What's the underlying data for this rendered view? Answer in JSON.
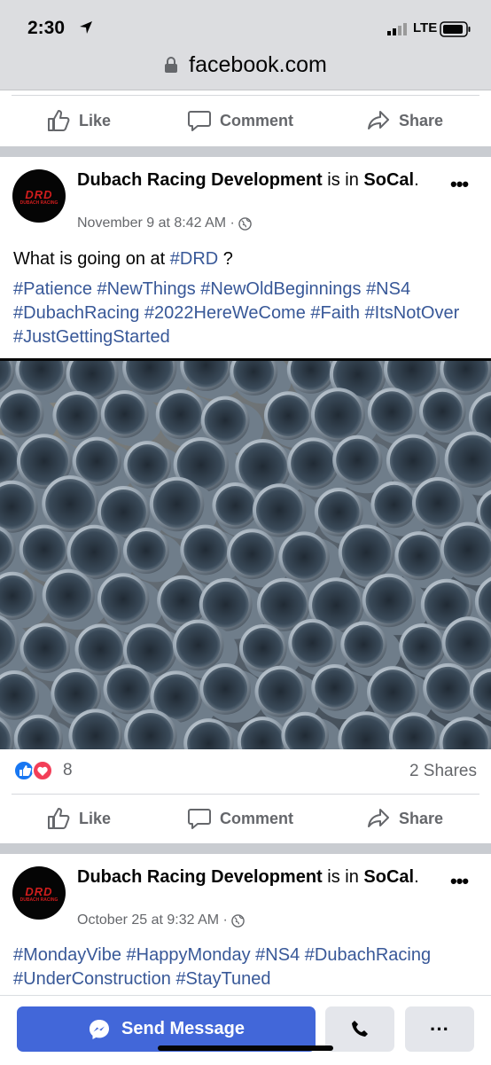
{
  "status_bar": {
    "time": "2:30",
    "network": "LTE"
  },
  "browser": {
    "url": "facebook.com"
  },
  "actions": {
    "like": "Like",
    "comment": "Comment",
    "share": "Share"
  },
  "post1": {
    "author": "Dubach Racing Development",
    "is_in": "is in",
    "location": "SoCal",
    "period": ".",
    "timestamp": "November 9 at 8:42 AM ·",
    "text_before": "What is going on at ",
    "text_hashtag": "#DRD",
    "text_after": " ?",
    "hashtags": [
      "#Patience",
      "#NewThings",
      "#NewOldBeginnings",
      "#NS4",
      "#DubachRacing",
      "#2022HereWeCome",
      "#Faith",
      "#ItsNotOver",
      "#JustGettingStarted"
    ],
    "reactions_count": "8",
    "shares": "2 Shares"
  },
  "post2": {
    "author": "Dubach Racing Development",
    "is_in": "is in",
    "location": "SoCal",
    "period": ".",
    "timestamp": "October 25 at 9:32 AM ·",
    "hashtags": [
      "#MondayVibe",
      "#HappyMonday",
      "#NS4",
      "#DubachRacing",
      "#UnderConstruction",
      "#StayTuned"
    ]
  },
  "avatar_logo": {
    "main": "DRD",
    "sub": "DUBACH RACING"
  },
  "bottom_bar": {
    "send_message": "Send Message",
    "more": "···"
  },
  "colors": {
    "brand_blue": "#4267d9",
    "hashtag": "#385898",
    "secondary_text": "#65676b",
    "like_blue": "#1877f2",
    "love_red": "#f33e58"
  },
  "icons": [
    "location-arrow-icon",
    "signal-icon",
    "battery-icon",
    "lock-icon",
    "like-icon",
    "comment-icon",
    "share-icon",
    "globe-icon",
    "more-icon",
    "messenger-icon",
    "phone-icon"
  ]
}
